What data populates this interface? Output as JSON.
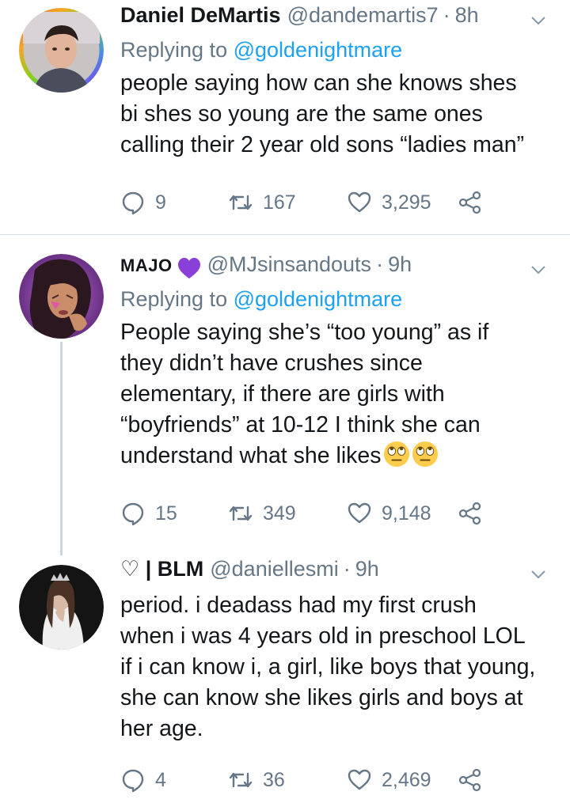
{
  "tweets": [
    {
      "name": "Daniel DeMartis",
      "handle": "@dandemartis7",
      "dot": "·",
      "time": "8h",
      "reply_prefix": "Replying to ",
      "reply_to": "@goldenightmare",
      "lines": [
        "people saying how can she knows shes",
        "bi shes so young are the same ones",
        "calling their 2 year old sons “ladies man”"
      ],
      "replies": "9",
      "retweets": "167",
      "likes": "3,295"
    },
    {
      "name": "MAJO",
      "handle": "@MJsinsandouts",
      "dot": "·",
      "time": "9h",
      "name_emoji": "purple-heart",
      "reply_prefix": "Replying to ",
      "reply_to": "@goldenightmare",
      "lines": [
        "People saying she’s “too young” as if",
        "they didn’t have crushes since",
        "elementary, if there are girls with",
        "“boyfriends” at 10-12 I think she can",
        "understand what she likes"
      ],
      "trailing_emoji": "face-with-rolling-eyes x2",
      "replies": "15",
      "retweets": "349",
      "likes": "9,148"
    },
    {
      "name": "♡ | BLM",
      "handle": "@daniellesmi",
      "dot": "·",
      "time": "9h",
      "lines": [
        "period. i deadass had my first crush",
        "when i was 4 years old in preschool LOL",
        "if i can know i, a girl, like boys that young,",
        "she can know she likes girls and boys at",
        "her age."
      ],
      "replies": "4",
      "retweets": "36",
      "likes": "2,469"
    }
  ],
  "colors": {
    "text": "#14171a",
    "muted": "#657786",
    "link": "#1da1f2",
    "divider": "#d6dde3",
    "thread": "#ccd6dd",
    "heart_purple": "#8b3fd9"
  }
}
